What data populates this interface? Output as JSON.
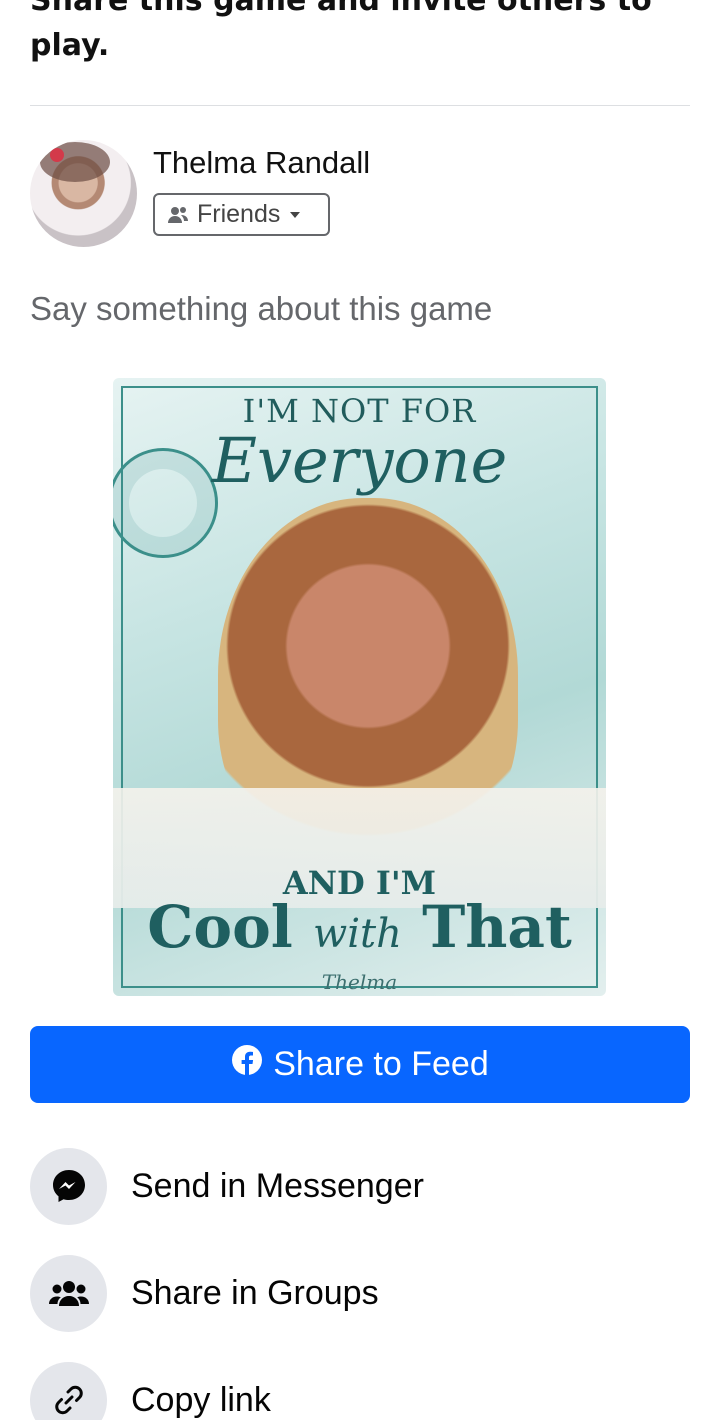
{
  "header": {
    "title": "Share this game and invite others to play."
  },
  "author": {
    "name": "Thelma Randall",
    "audience": "Friends"
  },
  "composer": {
    "placeholder": "Say something about this game"
  },
  "game_image": {
    "line1": "I'M NOT FOR",
    "line2": "Everyone",
    "line3": "AND I'M",
    "line4_a": "Cool",
    "line4_b": "with",
    "line4_c": "That",
    "signature": "Thelma"
  },
  "actions": {
    "share_feed": "Share to Feed",
    "messenger": "Send in Messenger",
    "groups": "Share in Groups",
    "copy_link": "Copy link"
  },
  "colors": {
    "primary": "#0866ff",
    "icon_bg": "#e4e6eb",
    "secondary_text": "#65676b"
  }
}
